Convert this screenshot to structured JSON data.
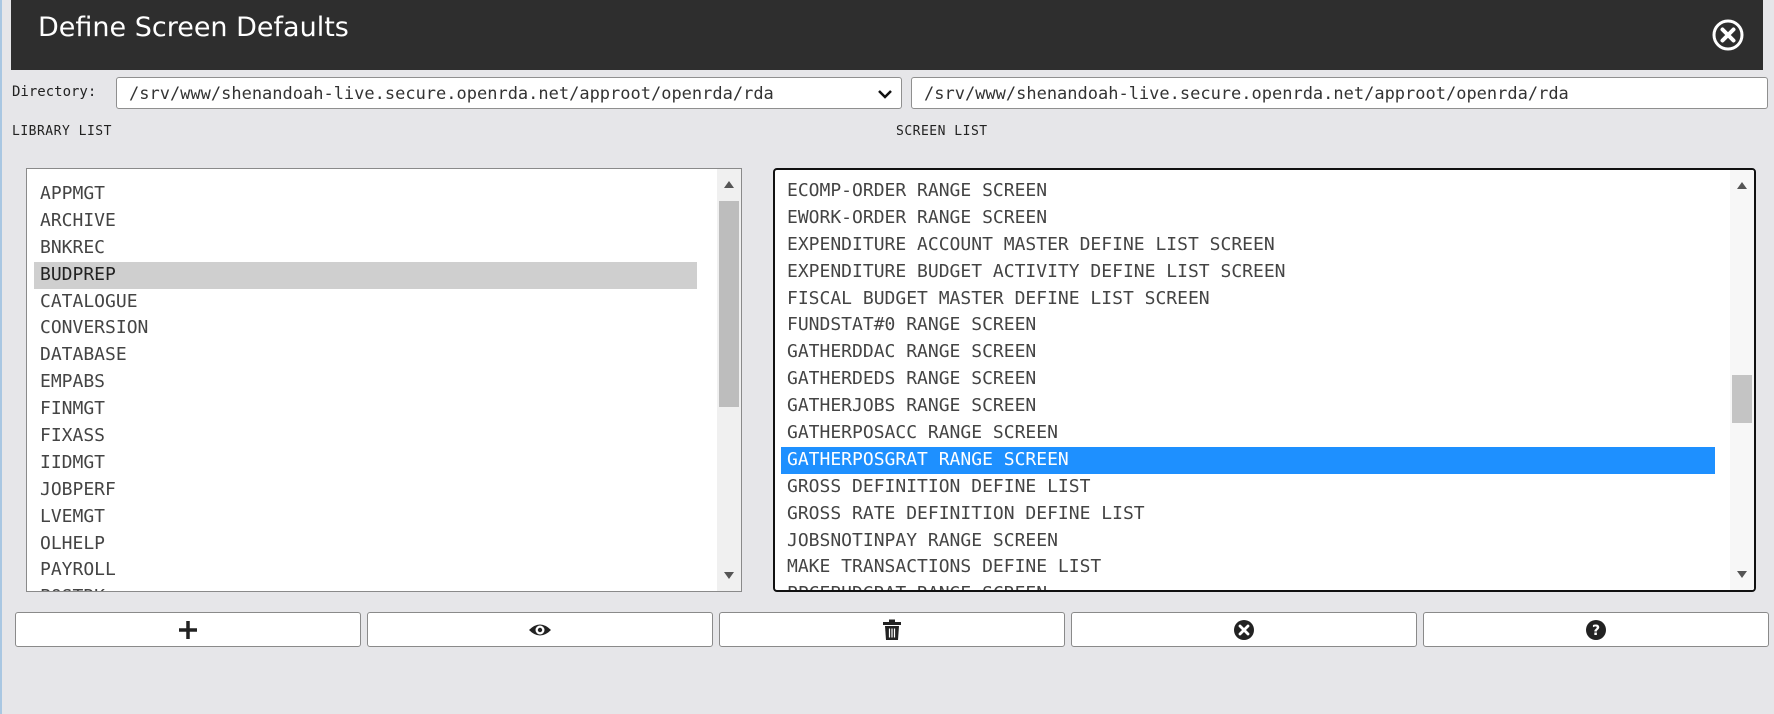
{
  "window": {
    "title": "Define Screen Defaults"
  },
  "directory": {
    "label": "Directory:",
    "selected": "/srv/www/shenandoah-live.secure.openrda.net/approot/openrda/rda",
    "input_value": "/srv/www/shenandoah-live.secure.openrda.net/approot/openrda/rda"
  },
  "library_list": {
    "label": "LIBRARY LIST",
    "items": [
      "APPMGT",
      "ARCHIVE",
      "BNKREC",
      "BUDPREP",
      "CATALOGUE",
      "CONVERSION",
      "DATABASE",
      "EMPABS",
      "FINMGT",
      "FIXASS",
      "IIDMGT",
      "JOBPERF",
      "LVEMGT",
      "OLHELP",
      "PAYROLL",
      "POSTRK"
    ],
    "selected": "BUDPREP"
  },
  "screen_list": {
    "label": "SCREEN LIST",
    "items": [
      "ECOMP-ORDER RANGE SCREEN",
      "EWORK-ORDER RANGE SCREEN",
      "EXPENDITURE ACCOUNT MASTER DEFINE LIST SCREEN",
      "EXPENDITURE BUDGET ACTIVITY DEFINE LIST SCREEN",
      "FISCAL BUDGET MASTER DEFINE LIST SCREEN",
      "FUNDSTAT#0 RANGE SCREEN",
      "GATHERDDAC RANGE SCREEN",
      "GATHERDEDS RANGE SCREEN",
      "GATHERJOBS RANGE SCREEN",
      "GATHERPOSACC RANGE SCREEN",
      "GATHERPOSGRAT RANGE SCREEN",
      "GROSS DEFINITION DEFINE LIST",
      "GROSS RATE DEFINITION DEFINE LIST",
      "JOBSNOTINPAY RANGE SCREEN",
      "MAKE TRANSACTIONS DEFINE LIST",
      "PPCEBUDGRAT RANGE SCREEN"
    ],
    "selected": "GATHERPOSGRAT RANGE SCREEN"
  },
  "buttons": [
    {
      "icon": "plus-icon"
    },
    {
      "icon": "eye-icon"
    },
    {
      "icon": "trash-icon"
    },
    {
      "icon": "close-circle-icon"
    },
    {
      "icon": "help-circle-icon"
    }
  ]
}
